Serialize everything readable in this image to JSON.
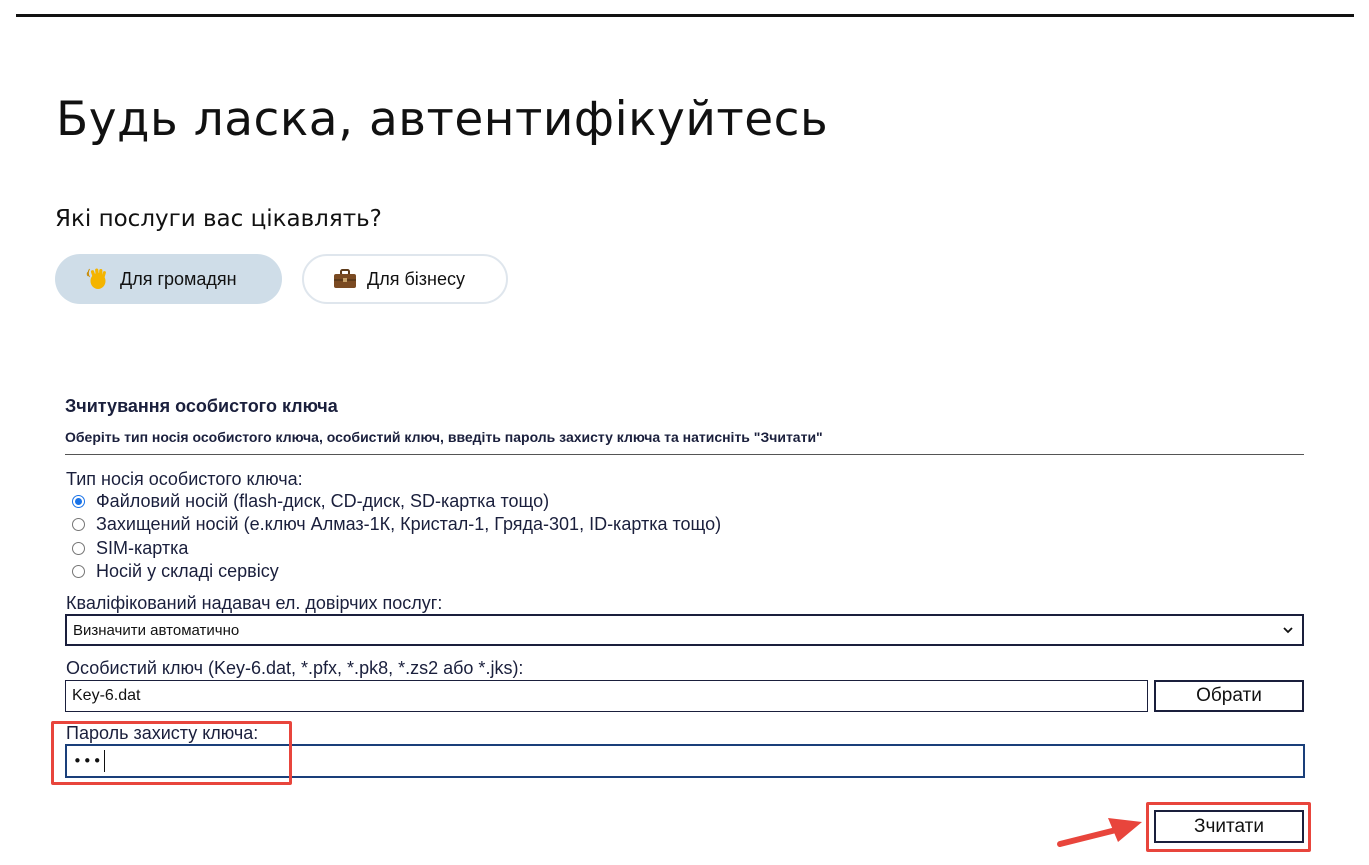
{
  "page": {
    "title": "Будь ласка, автентифікуйтесь",
    "services_heading": "Які послуги вас цікавлять?",
    "service_buttons": [
      {
        "label": "Для громадян",
        "icon": "waving-hand-icon",
        "selected": true
      },
      {
        "label": "Для бізнесу",
        "icon": "briefcase-icon",
        "selected": false
      }
    ]
  },
  "key_form": {
    "title": "Зчитування особистого ключа",
    "subtitle": "Оберіть тип носія особистого ключа, особистий ключ, введіть пароль захисту ключа та натисніть \"Зчитати\"",
    "media_type_label": "Тип носія особистого ключа:",
    "media_options": [
      {
        "label": "Файловий носій (flash-диск, CD-диск, SD-картка тощо)",
        "checked": true
      },
      {
        "label": "Захищений носій (е.ключ Алмаз-1К, Кристал-1, Гряда-301, ID-картка тощо)",
        "checked": false
      },
      {
        "label": "SIM-картка",
        "checked": false
      },
      {
        "label": "Носій у складі сервісу",
        "checked": false
      }
    ],
    "provider_label": "Кваліфікований надавач ел. довірчих послуг:",
    "provider_value": "Визначити автоматично",
    "key_file_label": "Особистий ключ (Key-6.dat, *.pfx, *.pk8, *.zs2 або *.jks):",
    "key_file_value": "Key-6.dat",
    "browse_label": "Обрати",
    "password_label": "Пароль захисту ключа:",
    "password_masked": "•••",
    "read_label": "Зчитати"
  },
  "colors": {
    "highlight": "#e8453c",
    "selected_pill": "#cfdde8",
    "form_text": "#1a1f3c",
    "radio_accent": "#1a73e8"
  }
}
